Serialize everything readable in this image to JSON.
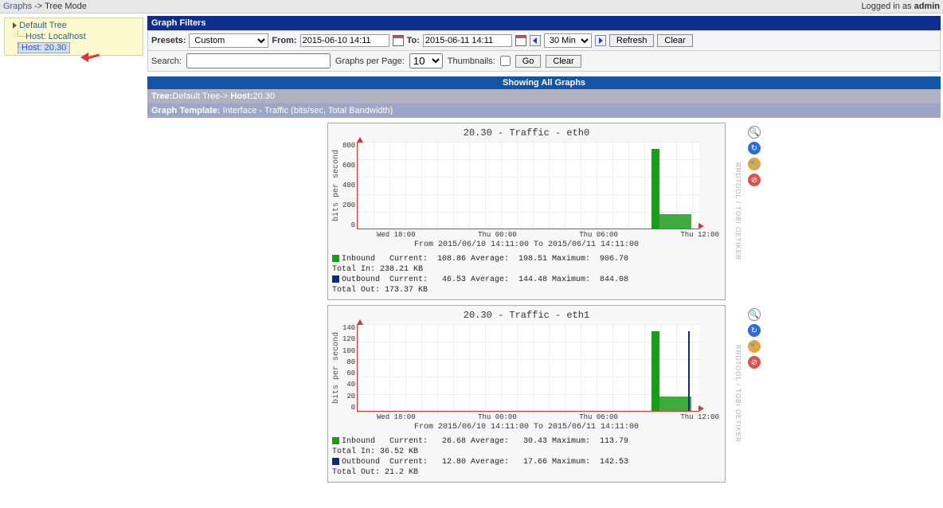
{
  "topbar": {
    "breadcrumb_graphs": "Graphs",
    "breadcrumb_sep": " -> ",
    "breadcrumb_mode": "Tree Mode",
    "logged_in_prefix": "Logged in as ",
    "logged_in_user": "admin"
  },
  "tree": {
    "root": "Default Tree",
    "items": [
      "Host: Localhost",
      "Host: 20.30"
    ],
    "selected_index": 1
  },
  "filters": {
    "header": "Graph Filters",
    "presets_label": "Presets:",
    "presets_value": "Custom",
    "from_label": "From:",
    "from_value": "2015-06-10 14:11",
    "to_label": "To:",
    "to_value": "2015-06-11 14:11",
    "interval_value": "30 Min",
    "refresh": "Refresh",
    "clear": "Clear",
    "search_label": "Search:",
    "search_value": "",
    "gpp_label": "Graphs per Page:",
    "gpp_value": "10",
    "thumbs_label": "Thumbnails:",
    "go": "Go",
    "clear2": "Clear"
  },
  "info": {
    "showing": "Showing All Graphs",
    "tree_label": "Tree:",
    "tree_value": "Default Tree",
    "sep": "-> ",
    "host_label": "Host:",
    "host_value": "20.30",
    "template_label": "Graph Template:",
    "template_value": " Interface - Traffic (bits/sec, Total Bandwidth)"
  },
  "side_watermark": "RRDTOOL / TOBI OETIKER",
  "graphs": [
    {
      "title": "20.30 - Traffic - eth0",
      "ylabel": "bits per second",
      "yticks": [
        "800",
        "600",
        "400",
        "200",
        "0"
      ],
      "xticks": [
        "Wed 18:00",
        "Thu 00:00",
        "Thu 06:00",
        "Thu 12:00"
      ],
      "range": "From 2015/06/10 14:11:00 To 2015/06/11 14:11:00",
      "rows": [
        {
          "swatch": "green",
          "name": "Inbound",
          "cur_l": "Current:",
          "cur": "108.86",
          "avg_l": "Average:",
          "avg": "198.51",
          "max_l": "Maximum:",
          "max": "906.70"
        },
        {
          "total_l": "Total In:",
          "total": "238.21 KB"
        },
        {
          "swatch": "blue",
          "name": "Outbound",
          "cur_l": "Current:",
          "cur": "46.53",
          "avg_l": "Average:",
          "avg": "144.48",
          "max_l": "Maximum:",
          "max": "844.08"
        },
        {
          "total_l": "Total Out:",
          "total": "173.37 KB"
        }
      ],
      "spike": false
    },
    {
      "title": "20.30 - Traffic - eth1",
      "ylabel": "bits per second",
      "yticks": [
        "140",
        "120",
        "100",
        "80",
        "60",
        "40",
        "20",
        "0"
      ],
      "xticks": [
        "Wed 18:00",
        "Thu 00:00",
        "Thu 06:00",
        "Thu 12:00"
      ],
      "range": "From 2015/06/10 14:11:00 To 2015/06/11 14:11:00",
      "rows": [
        {
          "swatch": "green",
          "name": "Inbound",
          "cur_l": "Current:",
          "cur": "26.68",
          "avg_l": "Average:",
          "avg": "30.43",
          "max_l": "Maximum:",
          "max": "113.79"
        },
        {
          "total_l": "Total In:",
          "total": "36.52 KB"
        },
        {
          "swatch": "blue",
          "name": "Outbound",
          "cur_l": "Current:",
          "cur": "12.80",
          "avg_l": "Average:",
          "avg": "17.66",
          "max_l": "Maximum:",
          "max": "142.53"
        },
        {
          "total_l": "Total Out:",
          "total": "21.2 KB"
        }
      ],
      "spike": true
    }
  ],
  "chart_data": [
    {
      "type": "line",
      "title": "20.30 - Traffic - eth0",
      "xlabel": "",
      "ylabel": "bits per second",
      "ylim": [
        0,
        900
      ],
      "x_range": "2015/06/10 14:11:00 to 2015/06/11 14:11:00",
      "series": [
        {
          "name": "Inbound",
          "current": 108.86,
          "average": 198.51,
          "maximum": 906.7,
          "total": "238.21 KB"
        },
        {
          "name": "Outbound",
          "current": 46.53,
          "average": 144.48,
          "maximum": 844.08,
          "total": "173.37 KB"
        }
      ]
    },
    {
      "type": "line",
      "title": "20.30 - Traffic - eth1",
      "xlabel": "",
      "ylabel": "bits per second",
      "ylim": [
        0,
        150
      ],
      "x_range": "2015/06/10 14:11:00 to 2015/06/11 14:11:00",
      "series": [
        {
          "name": "Inbound",
          "current": 26.68,
          "average": 30.43,
          "maximum": 113.79,
          "total": "36.52 KB"
        },
        {
          "name": "Outbound",
          "current": 12.8,
          "average": 17.66,
          "maximum": 142.53,
          "total": "21.2 KB"
        }
      ]
    }
  ]
}
